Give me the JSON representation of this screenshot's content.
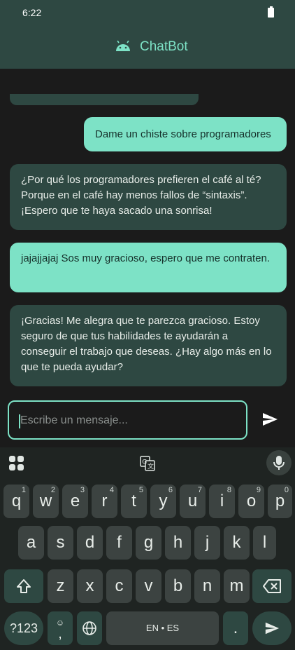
{
  "status": {
    "time": "6:22"
  },
  "appbar": {
    "title": "ChatBot"
  },
  "messages": [
    {
      "from": "user",
      "text": "Dame un chiste sobre programadores"
    },
    {
      "from": "bot",
      "text": "¿Por qué los programadores prefieren el café al té? Porque en el café hay menos fallos de “sintaxis”. ¡Espero que te haya sacado una sonrisa!"
    },
    {
      "from": "user",
      "text": "jajajjajaj Sos muy gracioso, espero que me contraten."
    },
    {
      "from": "bot",
      "text": "¡Gracias! Me alegra que te parezca gracioso. Estoy seguro de que tus habilidades te ayudarán a conseguir el trabajo que deseas. ¿Hay algo más en lo que te pueda ayudar?"
    }
  ],
  "input": {
    "placeholder": "Escribe un mensaje...",
    "value": ""
  },
  "keyboard": {
    "row1": [
      {
        "k": "q",
        "n": "1"
      },
      {
        "k": "w",
        "n": "2"
      },
      {
        "k": "e",
        "n": "3"
      },
      {
        "k": "r",
        "n": "4"
      },
      {
        "k": "t",
        "n": "5"
      },
      {
        "k": "y",
        "n": "6"
      },
      {
        "k": "u",
        "n": "7"
      },
      {
        "k": "i",
        "n": "8"
      },
      {
        "k": "o",
        "n": "9"
      },
      {
        "k": "p",
        "n": "0"
      }
    ],
    "row2": [
      "a",
      "s",
      "d",
      "f",
      "g",
      "h",
      "j",
      "k",
      "l"
    ],
    "row3": [
      "z",
      "x",
      "c",
      "v",
      "b",
      "n",
      "m"
    ],
    "symbols": "?123",
    "comma": ",",
    "space": "EN • ES",
    "period": "."
  },
  "colors": {
    "accent": "#7de2c6",
    "surface": "#2e4842",
    "background": "#1b1b1b"
  }
}
